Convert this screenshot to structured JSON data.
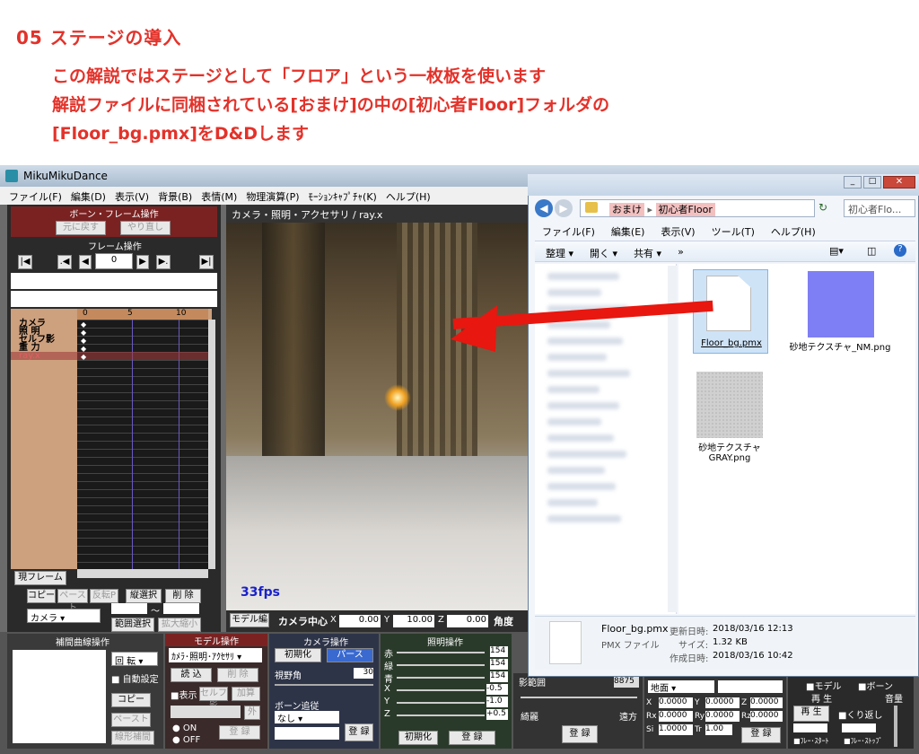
{
  "heading": "05 ステージの導入",
  "intro": {
    "line1": "この解説ではステージとして「フロア」という一枚板を使います",
    "line2": "解説ファイルに同梱されている[おまけ]の中の[初心者Floor]フォルダの",
    "line3": "[Floor_bg.pmx]をD&Dします"
  },
  "mmd": {
    "title": "MikuMikuDance",
    "menu": [
      "ファイル(F)",
      "編集(D)",
      "表示(V)",
      "背景(B)",
      "表情(M)",
      "物理演算(P)",
      "ﾓｰｼｮﾝｷｬﾌﾟﾁｬ(K)",
      "ヘルプ(H)"
    ],
    "bone_frame_title": "ボーン・フレーム操作",
    "undo": "元に戻す",
    "redo": "やり直し",
    "frame_op": "フレーム操作",
    "frame_value": "0",
    "tracks": [
      "カメラ",
      "照 明",
      "セルフ影",
      "重 力",
      "ray.x"
    ],
    "ruler": [
      "0",
      "5",
      "10"
    ],
    "current_frame_btn": "現フレーム",
    "copy": "コピー",
    "paste": "ペースト",
    "reverse_paste": "反転P",
    "vertical_select": "縦選択",
    "delete": "削 除",
    "tilde": "～",
    "range_select": "範囲選択",
    "expand": "拡大縮小",
    "camera_select": "カメラ",
    "viewport_title": "カメラ・照明・アクセサリ / ray.x",
    "fps": "33fps",
    "model_edit": "モデル編",
    "camera_center": "カメラ中心",
    "cam_x": "0.00",
    "cam_y": "10.00",
    "cam_z": "0.00",
    "angle": "角度",
    "interp_title": "補間曲線操作",
    "rotate": "回 転",
    "auto_setting": "自動設定",
    "interp_copy": "コピー",
    "interp_paste": "ペースト",
    "linear": "線形補間",
    "model_op": "モデル操作",
    "model_select": "ｶﾒﾗ･照明･ｱｸｾｻﾘ",
    "load": "読 込",
    "model_delete": "削 除",
    "display": "表示",
    "self_shadow": "セルフ影",
    "add": "加算",
    "outer": "外",
    "on": "ON",
    "off": "OFF",
    "model_register": "登 録",
    "camera_op": "カメラ操作",
    "init": "初期化",
    "perspective": "パース",
    "fov": "視野角",
    "fov_value": "30",
    "bone_follow": "ボーン追従",
    "none": "なし",
    "camera_register": "登 録",
    "light_op": "照明操作",
    "light_labels": [
      "赤",
      "緑",
      "青",
      "X",
      "Y",
      "Z"
    ],
    "light_values": [
      "154",
      "154",
      "154",
      "-0.5",
      "-1.0",
      "+0.5"
    ],
    "light_init": "初期化",
    "light_register": "登 録",
    "shadow_range": "影範囲",
    "shadow_value": "8875",
    "fine": "綺麗",
    "far": "遠方",
    "shadow_register": "登 録",
    "ground": "地面",
    "acc": {
      "X": "0.0000",
      "Y": "0.0000",
      "Z": "0.0000",
      "Rx": "0.0000",
      "Ry": "0.0000",
      "Rz": "0.0000",
      "Si": "1.0000",
      "Tr": "1.00"
    },
    "acc_register": "登 録",
    "model_check": "モデル",
    "bone_check": "ボーン",
    "play_title": "再 生",
    "play": "再 生",
    "loop": "くり返し",
    "frame_start": "ﾌﾚｰ･ｽﾀｰﾄ",
    "frame_stop": "ﾌﾚｰ･ｽﾄｯﾌﾟ",
    "volume": "音量"
  },
  "explorer": {
    "crumb1": "おまけ",
    "crumb2": "初心者Floor",
    "search": "初心者Flo...",
    "menu": [
      "ファイル(F)",
      "編集(E)",
      "表示(V)",
      "ツール(T)",
      "ヘルプ(H)"
    ],
    "toolbar": [
      "整理 ▾",
      "開く ▾",
      "共有 ▾",
      "»"
    ],
    "files": [
      {
        "name": "Floor_bg.pmx"
      },
      {
        "name": "砂地テクスチャ_NM.png"
      },
      {
        "name": "砂地テクスチャGRAY.png"
      }
    ],
    "detail": {
      "filename": "Floor_bg.pmx",
      "type": "PMX ファイル",
      "updated_label": "更新日時:",
      "updated": "2018/03/16 12:13",
      "size_label": "サイズ:",
      "size": "1.32 KB",
      "created_label": "作成日時:",
      "created": "2018/03/16 10:42"
    }
  }
}
